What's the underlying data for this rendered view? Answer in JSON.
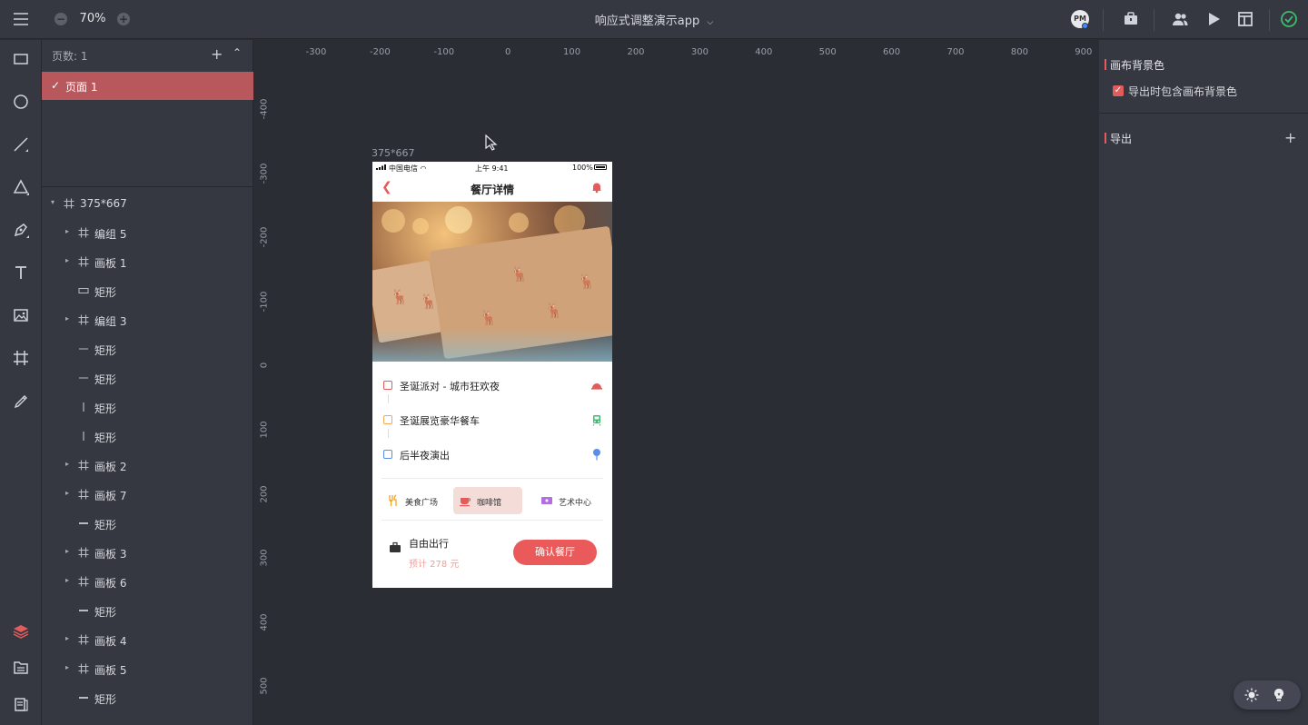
{
  "topbar": {
    "zoom": "70%",
    "title": "响应式调整演示app",
    "avatar_text": "PM"
  },
  "layers_panel": {
    "pages_label": "页数: 1",
    "current_page": "页面 1",
    "tree": [
      {
        "name": "375*667",
        "type": "artboard",
        "indent": 0,
        "expandable": true
      },
      {
        "name": "编组 5",
        "type": "group",
        "indent": 1,
        "expandable": true
      },
      {
        "name": "画板 1",
        "type": "artboard",
        "indent": 1,
        "expandable": true
      },
      {
        "name": "矩形",
        "type": "rect",
        "indent": 1,
        "expandable": false
      },
      {
        "name": "编组 3",
        "type": "group",
        "indent": 1,
        "expandable": true
      },
      {
        "name": "矩形",
        "type": "hline",
        "indent": 1,
        "expandable": false
      },
      {
        "name": "矩形",
        "type": "hline",
        "indent": 1,
        "expandable": false
      },
      {
        "name": "矩形",
        "type": "vline",
        "indent": 1,
        "expandable": false
      },
      {
        "name": "矩形",
        "type": "vline",
        "indent": 1,
        "expandable": false
      },
      {
        "name": "画板 2",
        "type": "artboard",
        "indent": 1,
        "expandable": true
      },
      {
        "name": "画板 7",
        "type": "artboard",
        "indent": 1,
        "expandable": true
      },
      {
        "name": "矩形",
        "type": "hbar",
        "indent": 1,
        "expandable": false
      },
      {
        "name": "画板 3",
        "type": "artboard",
        "indent": 1,
        "expandable": true
      },
      {
        "name": "画板 6",
        "type": "artboard",
        "indent": 1,
        "expandable": true
      },
      {
        "name": "矩形",
        "type": "hbar",
        "indent": 1,
        "expandable": false
      },
      {
        "name": "画板 4",
        "type": "artboard",
        "indent": 1,
        "expandable": true
      },
      {
        "name": "画板 5",
        "type": "artboard",
        "indent": 1,
        "expandable": true
      },
      {
        "name": "矩形",
        "type": "hbar",
        "indent": 1,
        "expandable": false
      }
    ]
  },
  "canvas": {
    "ruler_x": [
      "-300",
      "-200",
      "-100",
      "0",
      "100",
      "200",
      "300",
      "400",
      "500",
      "600",
      "700",
      "800",
      "900"
    ],
    "ruler_y": [
      "-400",
      "-300",
      "-200",
      "-100",
      "0",
      "100",
      "200",
      "300",
      "400",
      "500"
    ],
    "artboard_label": "375*667"
  },
  "phone": {
    "carrier": "中国电信",
    "time": "上午 9:41",
    "battery": "100%",
    "title": "餐厅详情",
    "routes": [
      {
        "text": "圣诞派对 - 城市狂欢夜",
        "color": "#e25c5c",
        "icon": "dish-icon"
      },
      {
        "text": "圣诞展览豪华餐车",
        "color": "#f0a95a",
        "icon": "tram-icon"
      },
      {
        "text": "后半夜演出",
        "color": "#5a8de8",
        "icon": "pin-icon"
      }
    ],
    "tabs": [
      {
        "label": "美食广场",
        "icon": "fork-icon",
        "active": false
      },
      {
        "label": "咖啡馆",
        "icon": "cup-icon",
        "active": true
      },
      {
        "label": "艺术中心",
        "icon": "ticket-icon",
        "active": false
      }
    ],
    "footer_title": "自由出行",
    "footer_price": "预计 278 元",
    "confirm": "确认餐厅"
  },
  "right_panel": {
    "canvas_bg": "画布背景色",
    "export_with_bg": "导出时包含画布背景色",
    "export": "导出"
  },
  "colors": {
    "accent": "#e25c5c",
    "page_selected": "#b8585d",
    "status_ok": "#3dbd6b"
  }
}
